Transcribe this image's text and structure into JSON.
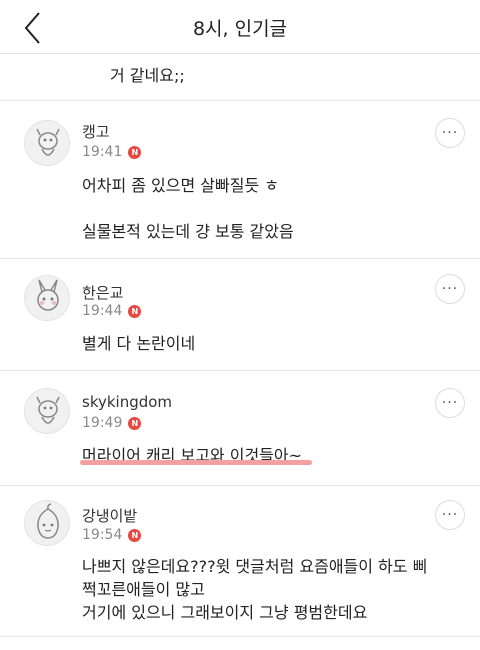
{
  "header": {
    "title": "8시, 인기글"
  },
  "prev_comment_tail": "거 같네요;;",
  "comments": [
    {
      "author": "캥고",
      "time": "19:41",
      "badge": "N",
      "lines": [
        "어차피 좀 있으면 살빠질듯 ㅎ",
        "실물본적 있는데 걍 보통 같았음"
      ],
      "more": "···"
    },
    {
      "author": "한은교",
      "time": "19:44",
      "badge": "N",
      "lines": [
        "별게 다 논란이네"
      ],
      "more": "···"
    },
    {
      "author": "skykingdom",
      "time": "19:49",
      "badge": "N",
      "lines": [
        "머라이어 캐리 보고와 이것들아~"
      ],
      "more": "···"
    },
    {
      "author": "강냉이밭",
      "time": "19:54",
      "badge": "N",
      "lines": [
        "나쁘지 않은데요???윗 댓글처럼 요즘애들이 하도 삐",
        "쩍꼬른애들이 많고",
        "거기에 있으니 그래보이지 그냥 평범한데요"
      ],
      "more": "···"
    }
  ]
}
